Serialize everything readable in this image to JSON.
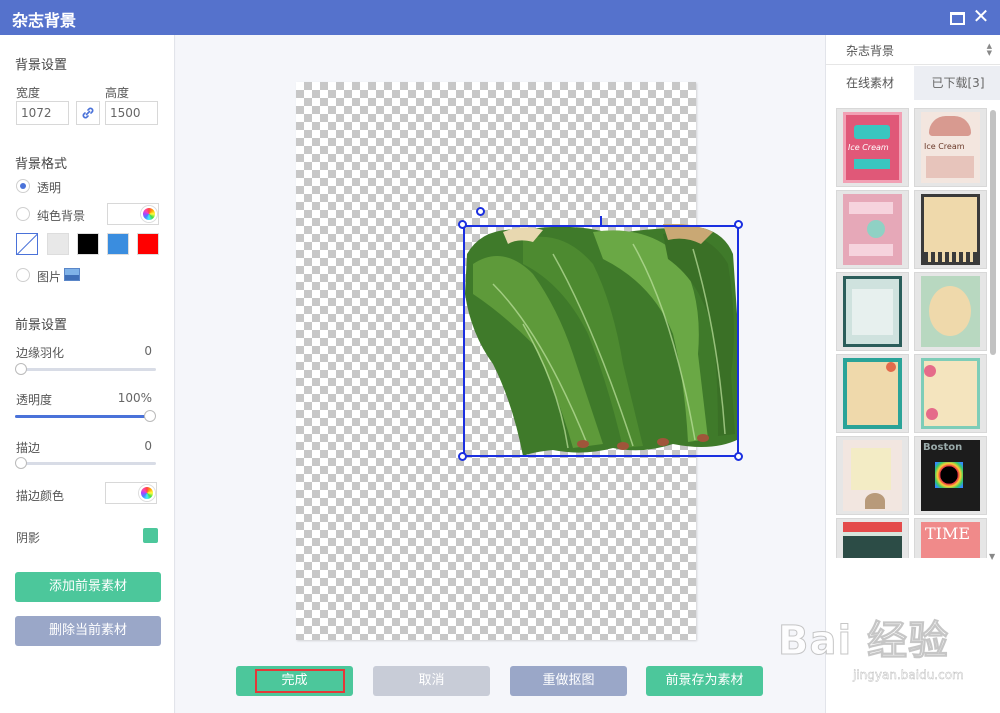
{
  "window": {
    "title": "杂志背景",
    "maximize_icon": "maximize-icon",
    "close_icon": "close-icon",
    "close_glyph": "✕"
  },
  "left": {
    "bg_settings_title": "背景设置",
    "width_label": "宽度",
    "height_label": "高度",
    "width_value": "1072",
    "height_value": "1500",
    "link_icon": "link-icon",
    "bg_format_title": "背景格式",
    "opt_transparent": "透明",
    "opt_solid": "纯色背景",
    "opt_image": "图片",
    "selected_format": "透明",
    "swatches": [
      "none",
      "#e8e8e8",
      "#000000",
      "#3a8ddf",
      "#ff0000"
    ],
    "fg_settings_title": "前景设置",
    "feather_label": "边缘羽化",
    "feather_value": "0",
    "opacity_label": "透明度",
    "opacity_value": "100%",
    "stroke_label": "描边",
    "stroke_value": "0",
    "stroke_color_label": "描边颜色",
    "shadow_label": "阴影",
    "shadow_color": "#4cc79b",
    "add_fg_button": "添加前景素材",
    "delete_fg_button": "删除当前素材"
  },
  "canvas": {
    "done": "完成",
    "cancel": "取消",
    "redo_matting": "重做抠图",
    "save_fg": "前景存为素材"
  },
  "right": {
    "category_select": "杂志背景",
    "tab_online": "在线素材",
    "tab_downloaded": "已下载[3]",
    "thumb_texts": [
      "Ice Cream",
      "Ice Cream",
      "Boston",
      "TIME"
    ]
  },
  "watermark": {
    "brand": "Bai 经验",
    "url": "jingyan.baidu.com"
  }
}
